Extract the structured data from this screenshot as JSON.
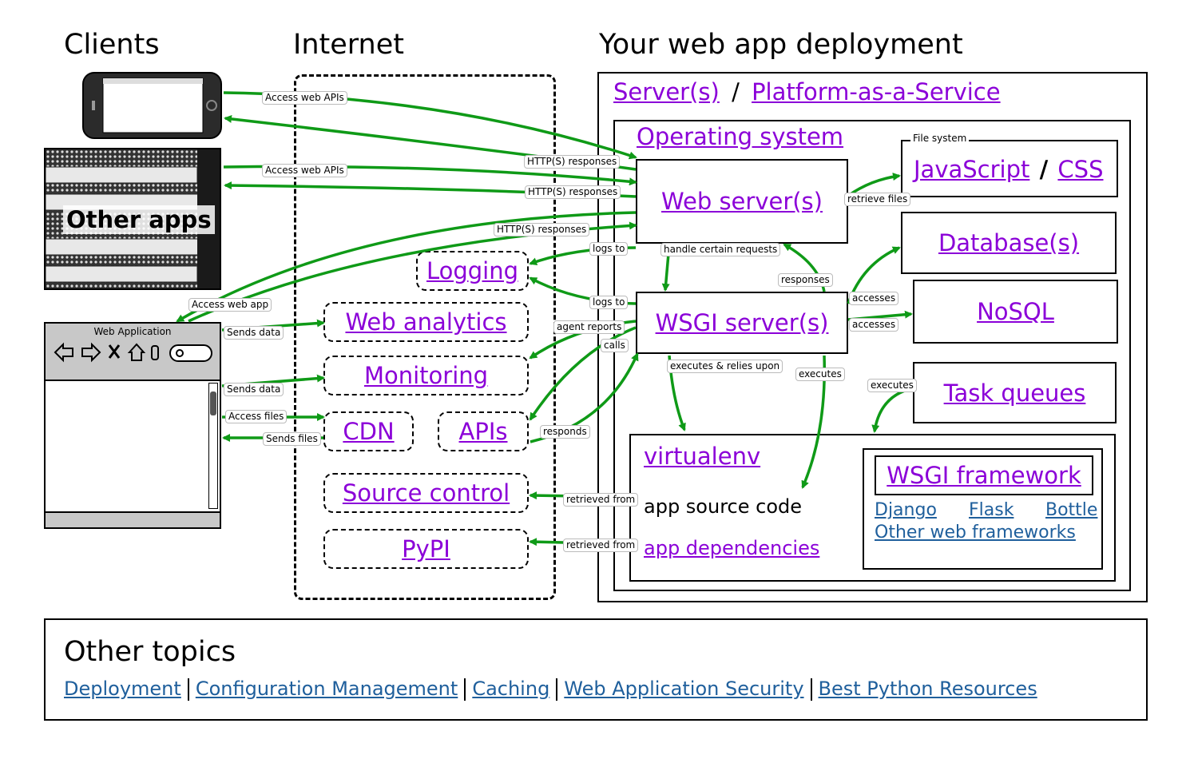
{
  "headings": {
    "clients": "Clients",
    "internet": "Internet",
    "deployment": "Your web app deployment"
  },
  "clients": {
    "other_apps": "Other apps",
    "webapp_title": "Web Application"
  },
  "internet": {
    "logging": "Logging",
    "web_analytics": "Web analytics",
    "monitoring": "Monitoring",
    "cdn": "CDN",
    "apis": "APIs",
    "source_control": "Source control",
    "pypi": "PyPI"
  },
  "deployment": {
    "servers": "Server(s)",
    "slash": "/",
    "paas": "Platform-as-a-Service",
    "os": "Operating system",
    "file_system": "File system",
    "javascript": "JavaScript",
    "css": "CSS",
    "web_servers": "Web server(s)",
    "databases": "Database(s)",
    "nosql": "NoSQL",
    "wsgi_servers": "WSGI server(s)",
    "task_queues": "Task queues",
    "virtualenv": "virtualenv",
    "app_source_code": "app source code",
    "app_dependencies": "app dependencies",
    "wsgi_framework": "WSGI framework",
    "django": "Django",
    "flask": "Flask",
    "bottle": "Bottle",
    "other_frameworks": "Other web frameworks"
  },
  "labels": {
    "access_web_apis_1": "Access web APIs",
    "access_web_apis_2": "Access web APIs",
    "http_responses_1": "HTTP(S) responses",
    "http_responses_2": "HTTP(S) responses",
    "http_responses_3": "HTTP(S) responses",
    "access_web_app": "Access web app",
    "sends_data_1": "Sends data",
    "sends_data_2": "Sends data",
    "access_files": "Access files",
    "sends_files": "Sends files",
    "logs_to_1": "logs to",
    "logs_to_2": "logs to",
    "handle_certain_requests": "handle certain requests",
    "responses": "responses",
    "retrieve_files": "retrieve files",
    "agent_reports": "agent reports",
    "calls": "calls",
    "responds": "responds",
    "accesses_1": "accesses",
    "accesses_2": "accesses",
    "executes_relies": "executes & relies upon",
    "executes_1": "executes",
    "executes_2": "executes",
    "retrieved_from_1": "retrieved from",
    "retrieved_from_2": "retrieved from"
  },
  "other_topics": {
    "title": "Other topics",
    "links": [
      "Deployment",
      "Configuration Management",
      "Caching",
      "Web Application Security",
      "Best Python Resources"
    ]
  },
  "colors": {
    "link_purple": "#8b00d8",
    "link_blue": "#1f5f9c",
    "arrow_green": "#0f9a17"
  }
}
